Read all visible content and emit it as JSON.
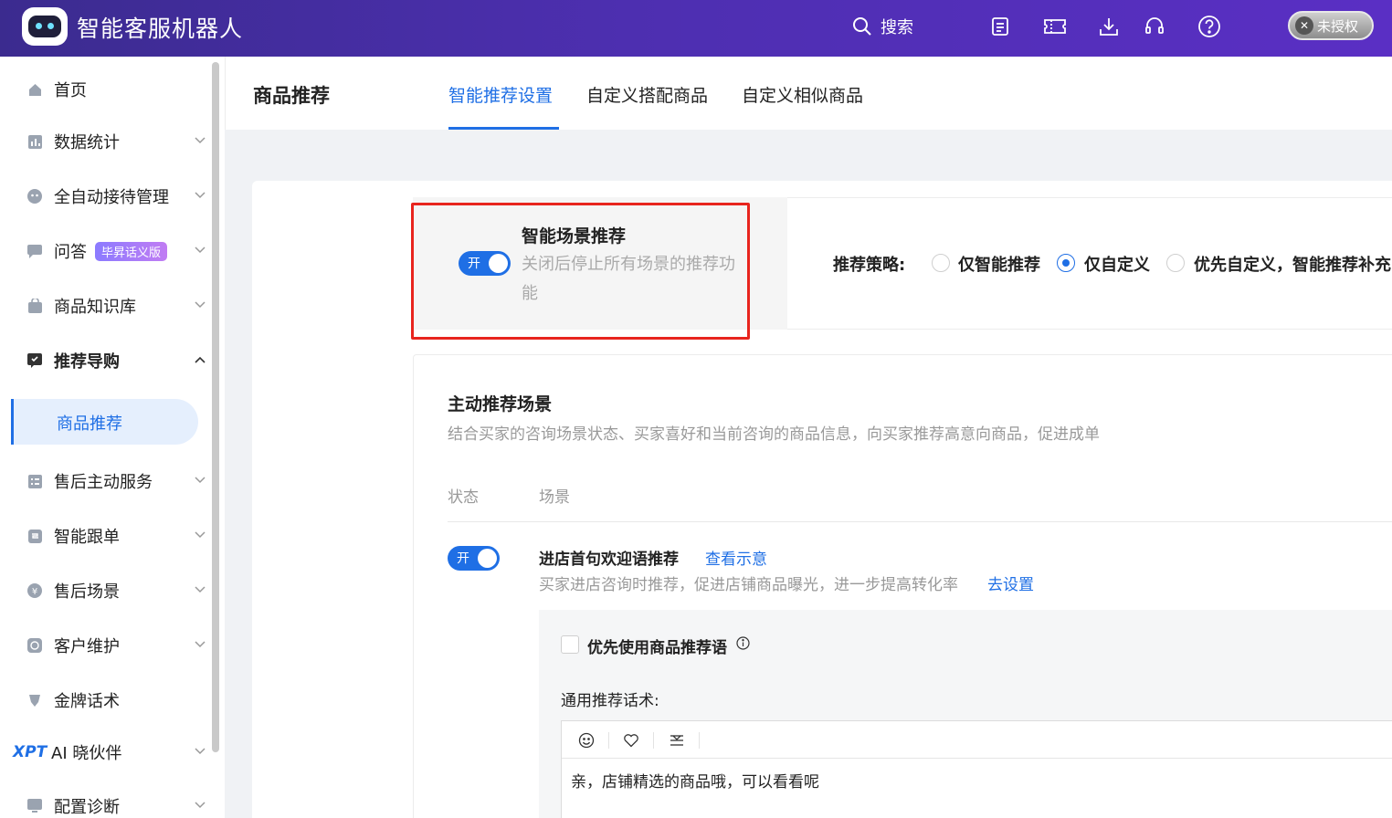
{
  "app": {
    "title": "智能客服机器人"
  },
  "topbar": {
    "search_label": "搜索",
    "icons": [
      "task-list-icon",
      "ticket-icon",
      "download-icon",
      "headset-icon",
      "help-icon"
    ],
    "auth_badge": "未授权"
  },
  "sidebar": {
    "items": [
      {
        "label": "首页",
        "icon": "home-icon"
      },
      {
        "label": "数据统计",
        "icon": "chart-icon"
      },
      {
        "label": "全自动接待管理",
        "icon": "robot-face-icon"
      },
      {
        "label": "问答",
        "icon": "chat-icon",
        "tag": "毕昇话义版"
      },
      {
        "label": "商品知识库",
        "icon": "bag-icon"
      },
      {
        "label": "推荐导购",
        "icon": "recommend-icon",
        "expanded": true
      },
      {
        "label": "售后主动服务",
        "icon": "service-list-icon"
      },
      {
        "label": "智能跟单",
        "icon": "tracking-icon"
      },
      {
        "label": "售后场景",
        "icon": "aftersale-icon"
      },
      {
        "label": "客户维护",
        "icon": "customer-icon"
      },
      {
        "label": "金牌话术",
        "icon": "medal-icon"
      },
      {
        "label": "AI 晓伙伴",
        "prefix": "XPT"
      },
      {
        "label": "配置诊断",
        "icon": "diagnose-icon"
      }
    ],
    "active_sub": "商品推荐"
  },
  "header": {
    "page_title": "商品推荐",
    "tabs": [
      "智能推荐设置",
      "自定义搭配商品",
      "自定义相似商品"
    ],
    "active_tab": 0
  },
  "smart_scene": {
    "switch_text": "开",
    "title": "智能场景推荐",
    "description": "关闭后停止所有场景的推荐功能",
    "strategy_label": "推荐策略:",
    "options": [
      "仅智能推荐",
      "仅自定义",
      "优先自定义，智能推荐补充"
    ],
    "selected_option": 1
  },
  "active_scene": {
    "title": "主动推荐场景",
    "description": "结合买家的咨询场景状态、买家喜好和当前咨询的商品信息，向买家推荐高意向商品，促进成单",
    "columns": [
      "状态",
      "场景"
    ],
    "rows": [
      {
        "switch_text": "开",
        "title": "进店首句欢迎语推荐",
        "view_link": "查看示意",
        "description": "买家进店咨询时推荐，促进店铺商品曝光，进一步提高转化率",
        "setup_link": "去设置",
        "prefer_checkbox_label": "优先使用商品推荐语",
        "general_label": "通用推荐话术:",
        "editor_text": "亲，店铺精选的商品哦，可以看看呢"
      }
    ]
  },
  "colors": {
    "primary": "#1f6fe5",
    "highlight_frame": "#e8251e",
    "topbar": "#4d2fb0"
  }
}
